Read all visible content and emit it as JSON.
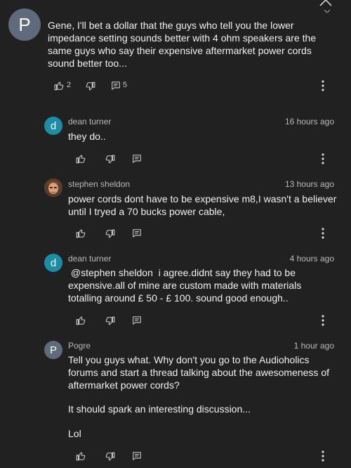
{
  "main_comment": {
    "avatar_letter": "P",
    "text": "Gene, I'll bet a dollar that the guys who tell you the lower impedance setting sounds better with 4 ohm speakers are the same guys who say their expensive aftermarket power cords sound better too...",
    "likes": "2",
    "replies": "5"
  },
  "replies": [
    {
      "author": "dean turner",
      "time": "16 hours ago",
      "avatar_letter": "d",
      "text": "they do.."
    },
    {
      "author": "stephen sheldon",
      "time": "13 hours ago",
      "avatar_letter": "",
      "text": "power cords dont  have to be expensive m8,I wasn't a believer until I tryed a 70 bucks power cable,"
    },
    {
      "author": "dean turner",
      "time": "4 hours ago",
      "avatar_letter": "d",
      "text": " @stephen sheldon  i agree.didnt say they had to be expensive.all of mine are custom made with materials totalling around £ 50 - £ 100. sound good enough.."
    },
    {
      "author": "Pogre",
      "time": "1 hour ago",
      "avatar_letter": "P",
      "text_lines": [
        "Tell you guys what. Why don't you go to the Audioholics forums and start a thread talking about the awesomeness of aftermarket power cords?",
        "It should spark an interesting discussion...",
        "Lol"
      ]
    }
  ],
  "colors": {
    "background": "#212121",
    "teal_avatar": "#1a8ea6",
    "grey_avatar": "#5f6b7a"
  },
  "icons": [
    "close-icon",
    "thumb-up-icon",
    "thumb-down-icon",
    "reply-icon",
    "more-vert-icon"
  ]
}
